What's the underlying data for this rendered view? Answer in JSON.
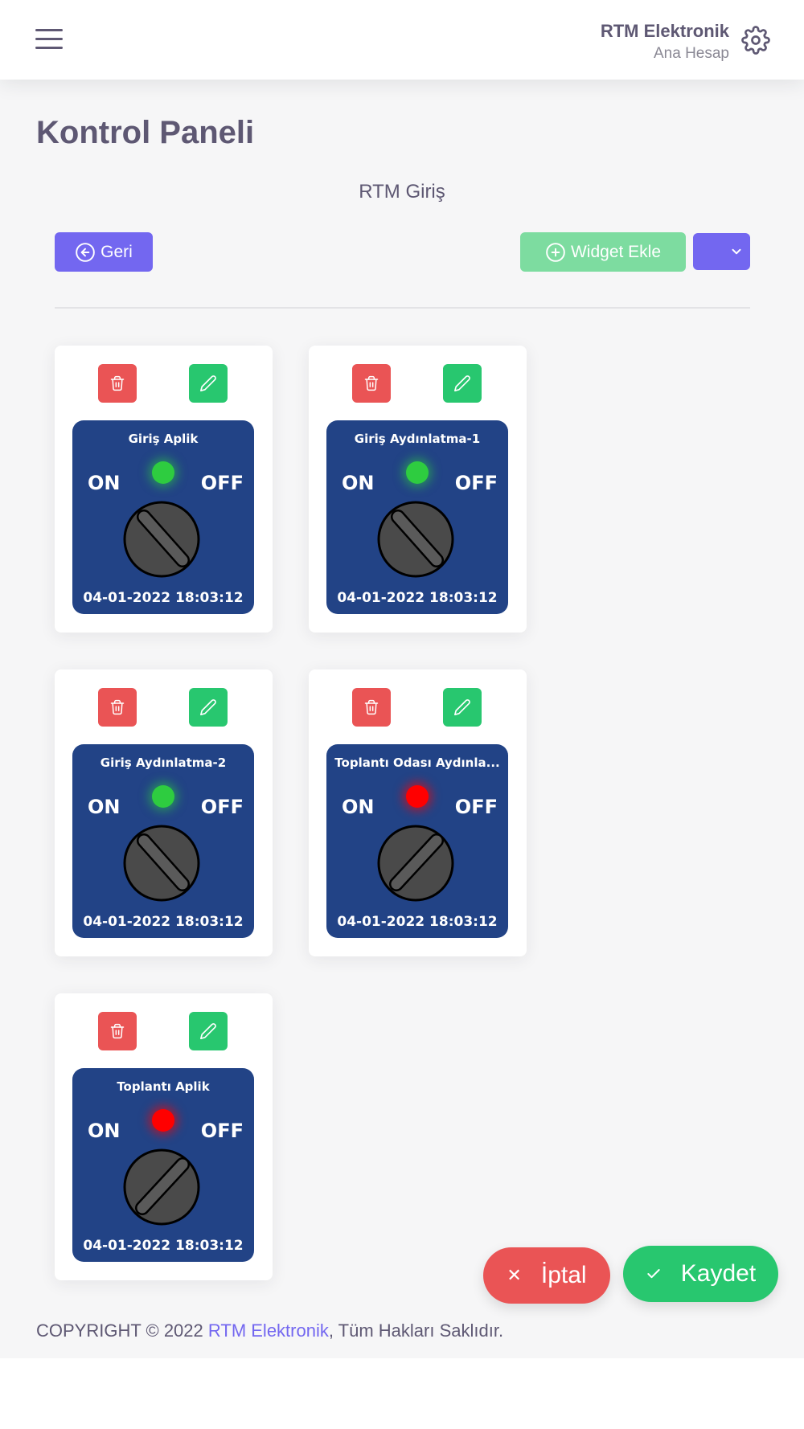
{
  "navbar": {
    "user_name": "RTM Elektronik",
    "user_role": "Ana Hesap"
  },
  "page": {
    "title": "Kontrol Paneli",
    "subtitle": "RTM Giriş"
  },
  "toolbar": {
    "back_label": "Geri",
    "add_widget_label": "Widget Ekle"
  },
  "widgets": [
    {
      "title": "Giriş Aplik",
      "on_label": "ON",
      "off_label": "OFF",
      "status": "on",
      "led_color": "#2ecc40",
      "timestamp": "04-01-2022 18:03:12"
    },
    {
      "title": "Giriş Aydınlatma-1",
      "on_label": "ON",
      "off_label": "OFF",
      "status": "on",
      "led_color": "#2ecc40",
      "timestamp": "04-01-2022 18:03:12"
    },
    {
      "title": "Giriş Aydınlatma-2",
      "on_label": "ON",
      "off_label": "OFF",
      "status": "on",
      "led_color": "#2ecc40",
      "timestamp": "04-01-2022 18:03:12"
    },
    {
      "title": "Toplantı Odası Aydınla...",
      "on_label": "ON",
      "off_label": "OFF",
      "status": "off",
      "led_color": "#ff0000",
      "timestamp": "04-01-2022 18:03:12"
    },
    {
      "title": "Toplantı Aplik",
      "on_label": "ON",
      "off_label": "OFF",
      "status": "off",
      "led_color": "#ff0000",
      "timestamp": "04-01-2022 18:03:12"
    }
  ],
  "actions": {
    "cancel_label": "İptal",
    "save_label": "Kaydet"
  },
  "footer": {
    "copyright": "COPYRIGHT © 2022 ",
    "brand": "RTM Elektronik",
    "rights": ", Tüm Hakları Saklıdır."
  },
  "colors": {
    "primary": "#7367f0",
    "success": "#28c76f",
    "danger": "#ea5455",
    "widget_bg": "#224386"
  }
}
